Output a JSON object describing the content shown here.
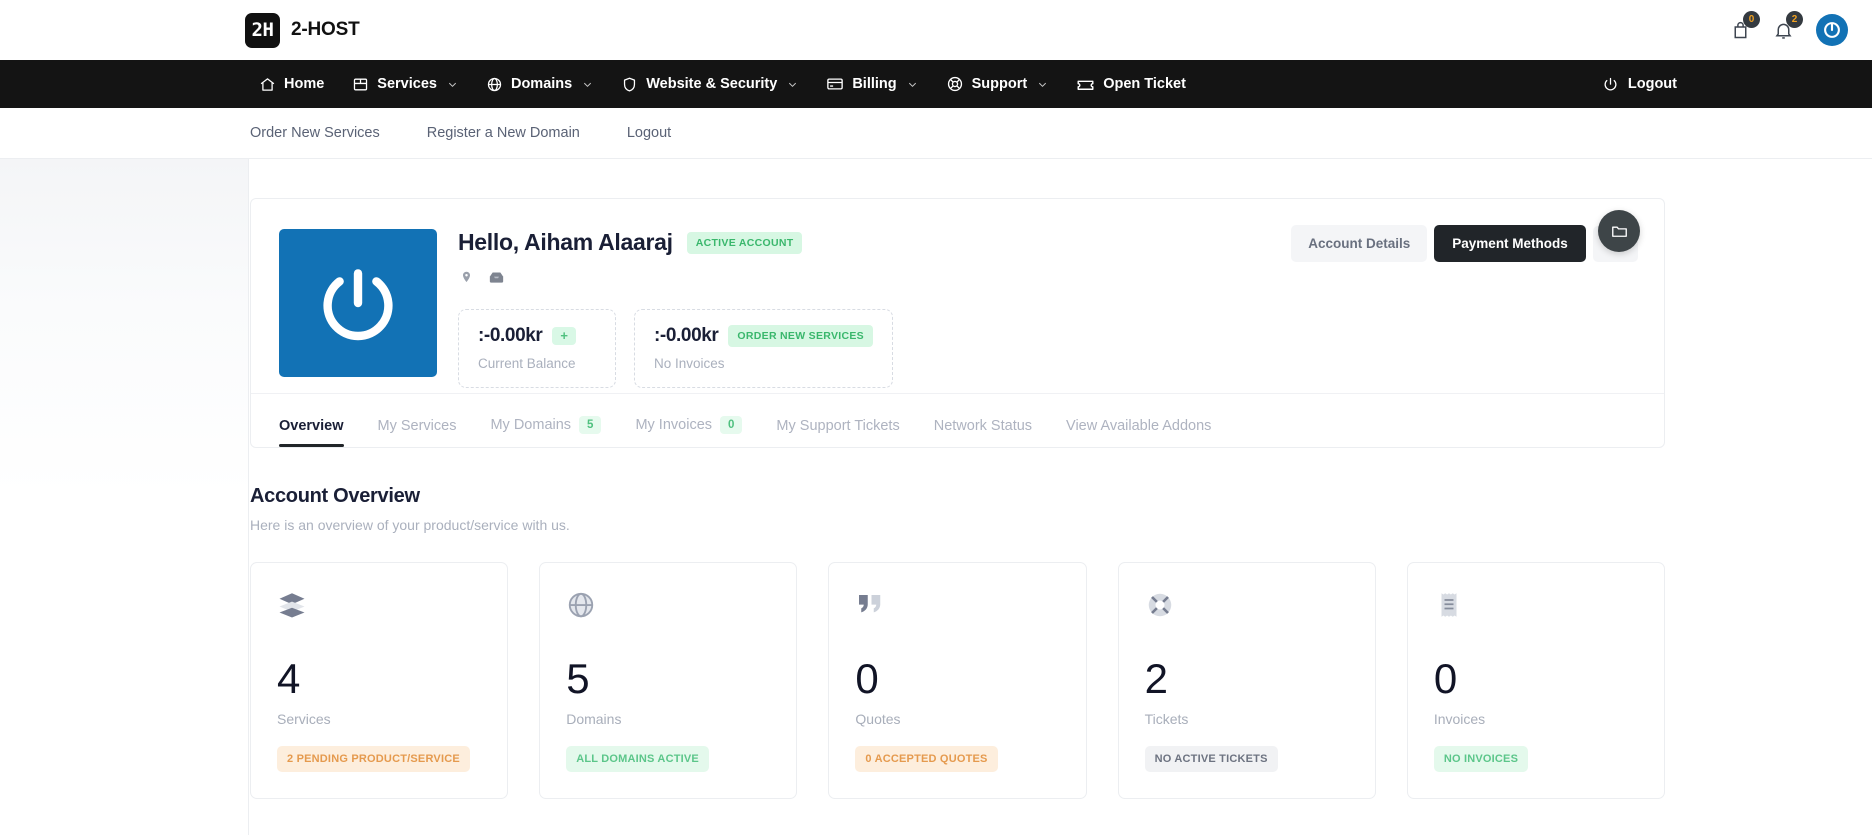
{
  "brand": {
    "mark": "2H",
    "name": "2-HOST"
  },
  "topbar": {
    "cart": {
      "icon": "cart-icon",
      "count": "0"
    },
    "bell": {
      "icon": "bell-icon",
      "count": "2"
    },
    "avatar": {
      "icon": "user-avatar-icon"
    }
  },
  "mainnav": {
    "items": [
      {
        "label": "Home",
        "icon": "home-icon",
        "caret": false
      },
      {
        "label": "Services",
        "icon": "box-icon",
        "caret": true
      },
      {
        "label": "Domains",
        "icon": "globe-icon",
        "caret": true
      },
      {
        "label": "Website & Security",
        "icon": "shield-icon",
        "caret": true
      },
      {
        "label": "Billing",
        "icon": "credit-card-icon",
        "caret": true
      },
      {
        "label": "Support",
        "icon": "lifebuoy-icon",
        "caret": true
      },
      {
        "label": "Open Ticket",
        "icon": "ticket-icon",
        "caret": false
      }
    ],
    "logout": {
      "label": "Logout",
      "icon": "power-icon"
    }
  },
  "subnav": {
    "items": [
      {
        "label": "Order New Services"
      },
      {
        "label": "Register a New Domain"
      },
      {
        "label": "Logout"
      }
    ]
  },
  "fab": {
    "icon": "folder-icon"
  },
  "account": {
    "greeting": "Hello, Aiham Alaaraj",
    "status_badge": "ACTIVE ACCOUNT",
    "meta_icons": [
      "map-pin-icon",
      "envelope-icon"
    ],
    "balances": [
      {
        "amount": ":-0.00kr",
        "badge": "+",
        "badge_type": "plus",
        "label": "Current Balance"
      },
      {
        "amount": ":-0.00kr",
        "badge": "ORDER NEW SERVICES",
        "badge_type": "green",
        "label": "No Invoices"
      }
    ],
    "actions": {
      "details": "Account Details",
      "payment": "Payment Methods",
      "more": "•••"
    }
  },
  "tabs": [
    {
      "label": "Overview",
      "badge": null,
      "active": true
    },
    {
      "label": "My Services",
      "badge": null,
      "active": false
    },
    {
      "label": "My Domains",
      "badge": "5",
      "active": false
    },
    {
      "label": "My Invoices",
      "badge": "0",
      "active": false
    },
    {
      "label": "My Support Tickets",
      "badge": null,
      "active": false
    },
    {
      "label": "Network Status",
      "badge": null,
      "active": false
    },
    {
      "label": "View Available Addons",
      "badge": null,
      "active": false
    }
  ],
  "overview": {
    "title": "Account Overview",
    "subtitle": "Here is an overview of your product/service with us.",
    "cards": [
      {
        "icon": "layers-icon",
        "value": "4",
        "label": "Services",
        "pill": "2 PENDING PRODUCT/SERVICE",
        "pill_style": "orange"
      },
      {
        "icon": "globe-icon",
        "value": "5",
        "label": "Domains",
        "pill": "ALL DOMAINS ACTIVE",
        "pill_style": "green"
      },
      {
        "icon": "quote-icon",
        "value": "0",
        "label": "Quotes",
        "pill": "0 ACCEPTED QUOTES",
        "pill_style": "orange"
      },
      {
        "icon": "lifebuoy-icon",
        "value": "2",
        "label": "Tickets",
        "pill": "NO ACTIVE TICKETS",
        "pill_style": "gray"
      },
      {
        "icon": "receipt-icon",
        "value": "0",
        "label": "Invoices",
        "pill": "NO INVOICES",
        "pill_style": "green"
      }
    ]
  },
  "colors": {
    "nav_bg": "#141414",
    "accent_blue": "#1272b5",
    "green": "#4fc07f",
    "orange": "#e59a4e",
    "dark": "#212529"
  }
}
